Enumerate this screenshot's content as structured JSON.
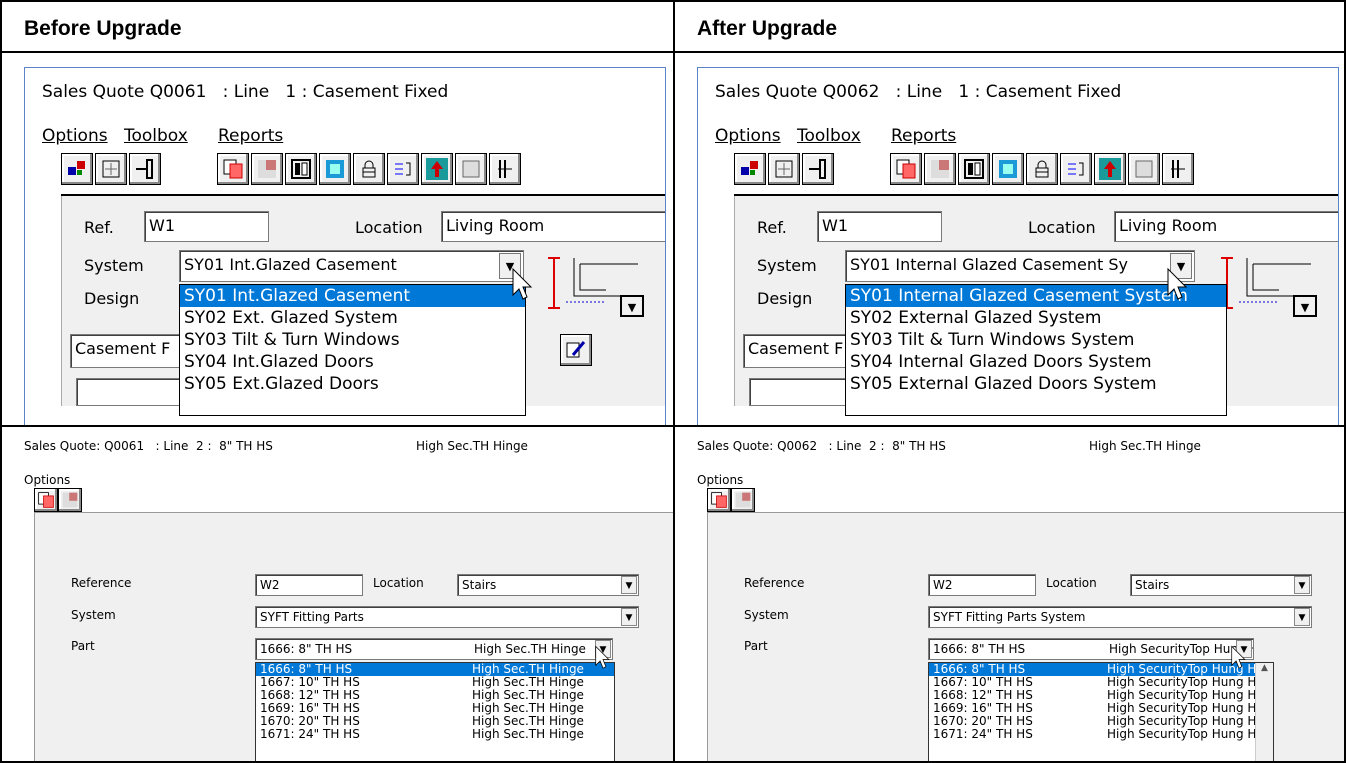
{
  "headers": {
    "before": "Before Upgrade",
    "after": "After Upgrade"
  },
  "top_before": {
    "title": "Sales Quote Q0061   : Line   1 : Casement Fixed",
    "menu": [
      "Options",
      "Toolbox",
      "Reports"
    ],
    "ref_label": "Ref.",
    "ref_value": "W1",
    "location_label": "Location",
    "location_value": "Living Room",
    "system_label": "System",
    "system_value": "SY01  Int.Glazed Casement",
    "design_label": "Design",
    "design_value": "Casement F",
    "list": [
      "SY01  Int.Glazed Casement",
      "SY02  Ext. Glazed System",
      "SY03  Tilt & Turn Windows",
      "SY04  Int.Glazed Doors",
      "SY05  Ext.Glazed Doors"
    ]
  },
  "top_after": {
    "title": "Sales Quote Q0062   : Line   1 : Casement Fixed",
    "menu": [
      "Options",
      "Toolbox",
      "Reports"
    ],
    "ref_label": "Ref.",
    "ref_value": "W1",
    "location_label": "Location",
    "location_value": "Living Room",
    "system_label": "System",
    "system_value": "SY01  Internal Glazed Casement Sy",
    "design_label": "Design",
    "design_value": "Casement F",
    "list": [
      "SY01  Internal Glazed Casement System",
      "SY02  External Glazed System",
      "SY03  Tilt & Turn Windows System",
      "SY04  Internal Glazed Doors System",
      "SY05  External Glazed Doors System"
    ]
  },
  "bottom_before": {
    "title": "Sales Quote: Q0061   : Line  2 :  8\" TH HS",
    "title_right": "High Sec.TH Hinge",
    "menu": "Options",
    "reference_label": "Reference",
    "reference_value": "W2",
    "location_label": "Location",
    "location_value": "Stairs",
    "system_label": "System",
    "system_value": "SYFT  Fitting Parts",
    "part_label": "Part",
    "part_value": "1666:  8\" TH HS",
    "part_desc": "High Sec.TH Hinge",
    "list": [
      {
        "code": "1666:  8\" TH HS",
        "desc": "High Sec.TH Hinge"
      },
      {
        "code": "1667: 10\" TH HS",
        "desc": "High Sec.TH Hinge"
      },
      {
        "code": "1668: 12\" TH HS",
        "desc": "High Sec.TH Hinge"
      },
      {
        "code": "1669: 16\" TH HS",
        "desc": "High Sec.TH Hinge"
      },
      {
        "code": "1670: 20\" TH HS",
        "desc": "High Sec.TH Hinge"
      },
      {
        "code": "1671: 24\" TH HS",
        "desc": "High Sec.TH Hinge"
      }
    ]
  },
  "bottom_after": {
    "title": "Sales Quote: Q0062   : Line  2 :  8\" TH HS",
    "title_right": "High Sec.TH Hinge",
    "menu": "Options",
    "reference_label": "Reference",
    "reference_value": "W2",
    "location_label": "Location",
    "location_value": "Stairs",
    "system_label": "System",
    "system_value": "SYFT  Fitting Parts System",
    "part_label": "Part",
    "part_value": "1666:  8\" TH HS",
    "part_desc": "High SecurityTop Hung H",
    "list": [
      {
        "code": "1666:  8\" TH HS",
        "desc": "High SecurityTop Hung Hinge"
      },
      {
        "code": "1667: 10\" TH HS",
        "desc": "High SecurityTop Hung Hinge"
      },
      {
        "code": "1668: 12\" TH HS",
        "desc": "High SecurityTop Hung Hinge"
      },
      {
        "code": "1669: 16\" TH HS",
        "desc": "High SecurityTop Hung Hinge"
      },
      {
        "code": "1670: 20\" TH HS",
        "desc": "High SecurityTop Hung Hinge"
      },
      {
        "code": "1671: 24\" TH HS",
        "desc": "High SecurityTop Hung Hinge"
      }
    ]
  },
  "colors": {
    "selection": "#0078d7",
    "window_border": "#5a84c8",
    "panel": "#f0f0f0"
  }
}
